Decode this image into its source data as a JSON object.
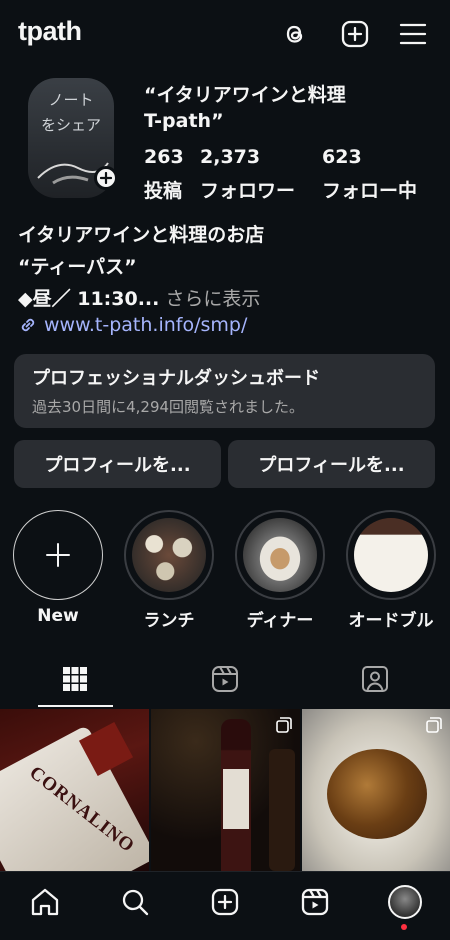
{
  "header": {
    "username": "tpath",
    "icons": [
      "threads-icon",
      "create-icon",
      "menu-icon"
    ]
  },
  "profile": {
    "note_text": "ノート\nをシェア",
    "display_name": "“イタリアワインと料理\nT-path”",
    "stats": [
      {
        "value": "263",
        "label": "投稿"
      },
      {
        "value": "2,373",
        "label": "フォロワー"
      },
      {
        "value": "623",
        "label": "フォロー中"
      }
    ],
    "bio_line1": "イタリアワインと料理のお店",
    "bio_line2": "“ティーパス”",
    "bio_line3": "◆昼／ 11:30...",
    "bio_more": " さらに表示",
    "link": "www.t-path.info/smp/"
  },
  "dashboard": {
    "title": "プロフェッショナルダッシュボード",
    "subtitle": "過去30日間に4,294回閲覧されました。"
  },
  "buttons": {
    "edit_profile": "プロフィールを...",
    "share_profile": "プロフィールを..."
  },
  "highlights": [
    {
      "label": "New"
    },
    {
      "label": "ランチ"
    },
    {
      "label": "ディナー"
    },
    {
      "label": "オードブル"
    }
  ],
  "tabs": [
    "grid-icon",
    "reels-icon",
    "tagged-icon"
  ],
  "posts": [
    {
      "caption": "CORNALINO"
    },
    {
      "caption": ""
    },
    {
      "caption": ""
    }
  ],
  "colors": {
    "background": "#0c1014",
    "surface": "#2a2d32",
    "link": "#a5b4fc",
    "notification": "#ff3040"
  }
}
